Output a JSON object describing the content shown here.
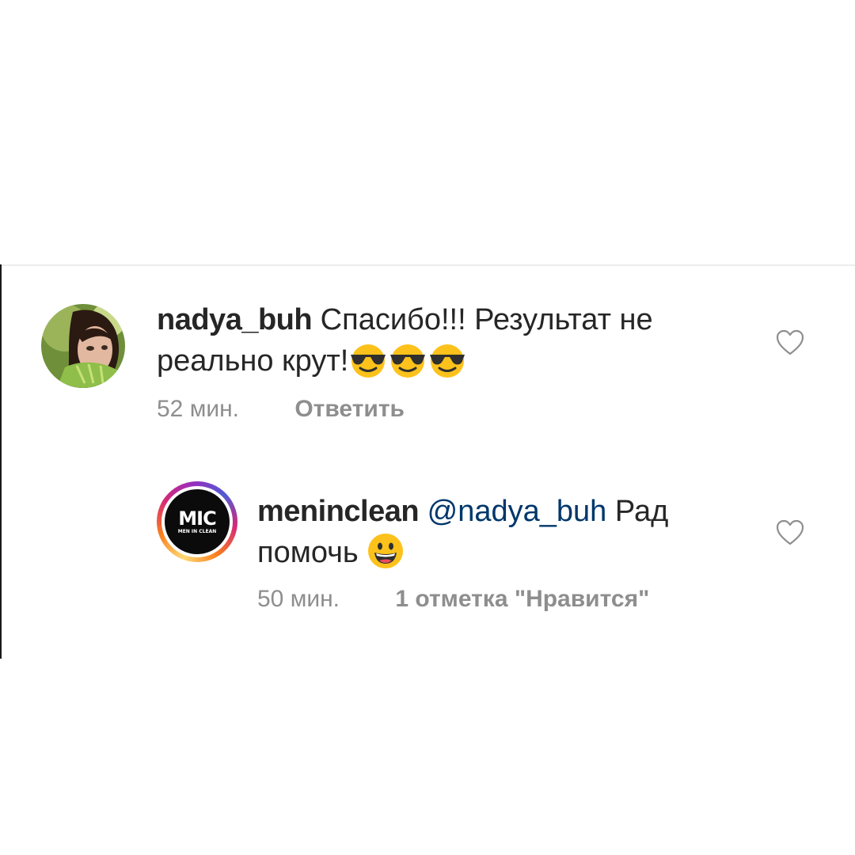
{
  "comments": [
    {
      "username": "nadya_buh",
      "text_before_emoji": "Спасибо!!! Результат не реально крут!",
      "emoji_names": [
        "sunglasses-emoji",
        "sunglasses-emoji",
        "sunglasses-emoji"
      ],
      "time": "52 мин.",
      "action": "Ответить",
      "avatar": "profile-photo"
    },
    {
      "username": "meninclean",
      "mention": "@nadya_buh",
      "text_before_emoji": "Рад помочь",
      "emoji_names": [
        "grinning-emoji"
      ],
      "time": "50 мин.",
      "likes_label": "1 отметка \"Нравится\"",
      "avatar": {
        "logo_text": "MIC",
        "logo_subtitle": "MEN IN CLEAN"
      }
    }
  ],
  "icons": {
    "like": "heart-outline-icon"
  },
  "colors": {
    "text": "#262626",
    "secondary": "#8e8e8e",
    "mention": "#00376b",
    "divider": "#ececec"
  }
}
